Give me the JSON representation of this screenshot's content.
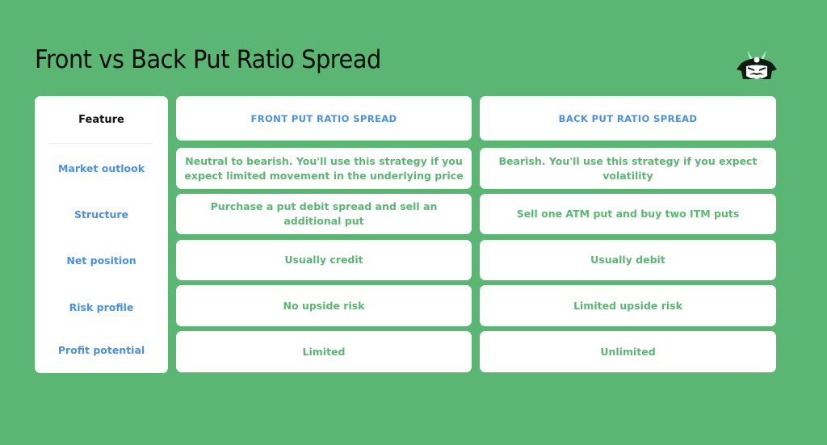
{
  "title": "Front vs Back Put Ratio Spread",
  "logo": {
    "icon": "samurai-helmet-icon"
  },
  "table": {
    "feature_header": "Feature",
    "columns": [
      "FRONT PUT RATIO SPREAD",
      "BACK PUT RATIO SPREAD"
    ],
    "rows": [
      {
        "feature": "Market outlook",
        "front": "Neutral to bearish. You'll use this strategy if you expect limited movement in the underlying price",
        "back": "Bearish. You'll use this strategy if you expect volatility"
      },
      {
        "feature": "Structure",
        "front": "Purchase a put debit spread and sell an additional put",
        "back": "Sell one ATM put and buy two ITM puts"
      },
      {
        "feature": "Net position",
        "front": "Usually credit",
        "back": "Usually debit"
      },
      {
        "feature": "Risk profile",
        "front": "No upside risk",
        "back": "Limited upside risk"
      },
      {
        "feature": "Profit potential",
        "front": "Limited",
        "back": "Unlimited"
      }
    ]
  },
  "colors": {
    "background": "#5bb673",
    "header_text": "#4a90e2",
    "cell_text": "#5bb673",
    "card": "#ffffff"
  }
}
